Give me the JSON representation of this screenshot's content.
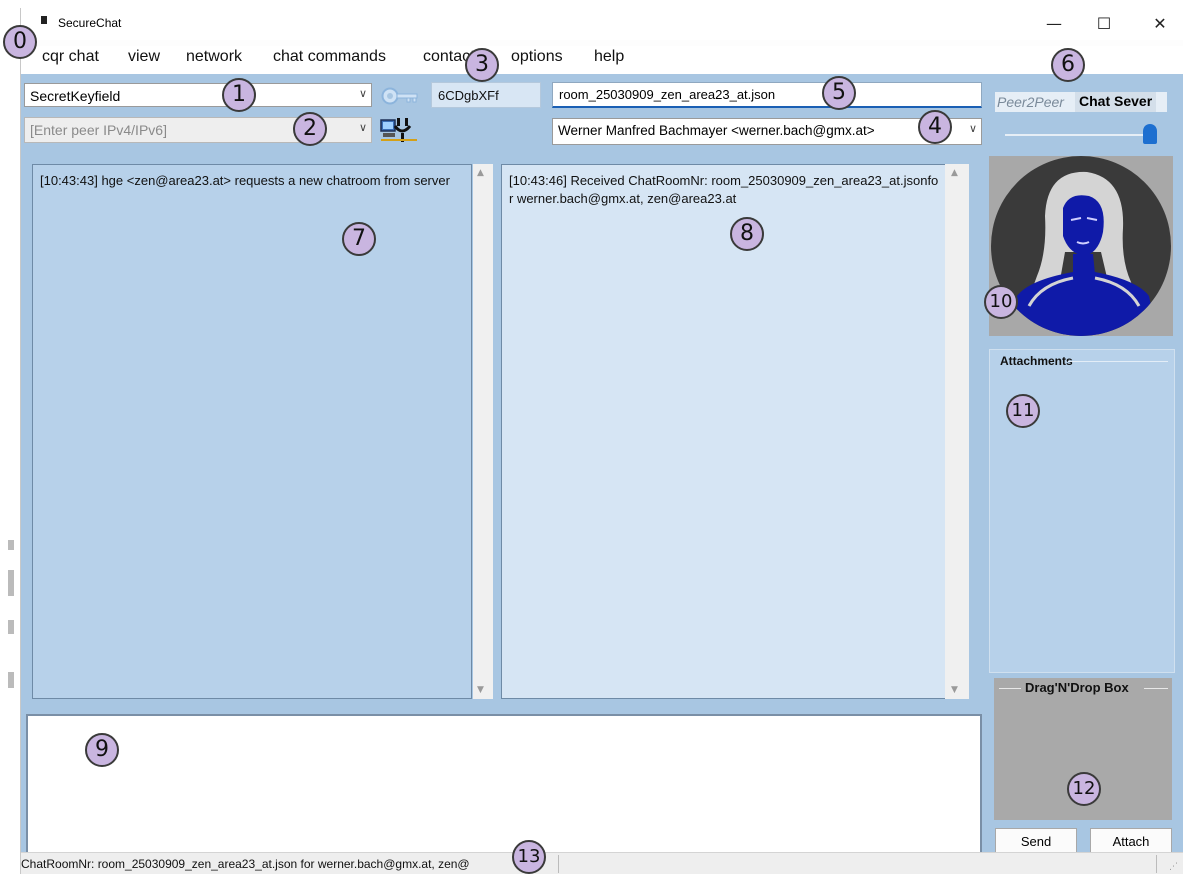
{
  "window": {
    "title": "SecureChat",
    "minimize": "—",
    "maximize": "☐",
    "close": "✕"
  },
  "menu": [
    "cqr chat",
    "view",
    "network",
    "chat commands",
    "contacts",
    "options",
    "help"
  ],
  "toolbar": {
    "key_select": "SecretKeyfield",
    "peer_ip_placeholder": "[Enter peer IPv4/IPv6]",
    "hash": "6CDgbXFf",
    "room_file": "room_25030909_zen_area23_at.json",
    "contact": "Werner Manfred Bachmayer <werner.bach@gmx.at>"
  },
  "mode": {
    "peer2peer": "Peer2Peer",
    "chat_server": "Chat Sever"
  },
  "chat": {
    "left_message": "[10:43:43] hge <zen@area23.at> requests a new chatroom from server",
    "right_message": "[10:43:46] Received ChatRoomNr: room_25030909_zen_area23_at.jsonfor werner.bach@gmx.at, zen@area23.at"
  },
  "attachments": {
    "title": "Attachments"
  },
  "dragdrop": {
    "title": "Drag'N'Drop Box"
  },
  "buttons": {
    "send": "Send",
    "attach": "Attach"
  },
  "status": {
    "text": "ChatRoomNr: room_25030909_zen_area23_at.json for werner.bach@gmx.at, zen@"
  },
  "callouts": [
    "0",
    "1",
    "2",
    "3",
    "4",
    "5",
    "6",
    "7",
    "8",
    "9",
    "10",
    "11",
    "12",
    "13"
  ],
  "colors": {
    "client_bg": "#a8c6e2",
    "left_chat_bg": "#b7d1ea",
    "right_chat_bg": "#d6e5f4",
    "callout_fill": "#c9b5e0",
    "avatar_fill": "#0f1aa8"
  }
}
